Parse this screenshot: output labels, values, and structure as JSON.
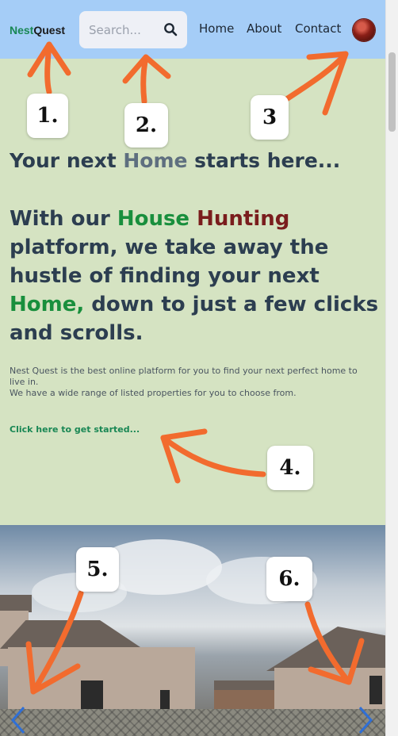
{
  "brand": {
    "part1": "Nest",
    "part2": "Quest"
  },
  "search": {
    "placeholder": "Search..."
  },
  "nav": {
    "links": [
      "Home",
      "About",
      "Contact"
    ]
  },
  "hero": {
    "title_pre": "Your next ",
    "title_hl": "Home",
    "title_post": " starts here...",
    "sub_1": "With our ",
    "sub_house": "House",
    "sub_space": " ",
    "sub_hunting": "Hunting",
    "sub_2": " platform, we take away the hustle of finding your next ",
    "sub_home": "Home,",
    "sub_3": " down to just a few clicks and scrolls.",
    "desc_1": "Nest Quest is the best online platform for you to find your next perfect home to live in.",
    "desc_2": "We have a wide range of listed properties for you to choose from.",
    "cta": "Click here to get started..."
  },
  "annotations": [
    "1.",
    "2.",
    "3",
    "4.",
    "5.",
    "6."
  ],
  "colors": {
    "navbar": "#a5cdf7",
    "page_bg": "#d5e3c2",
    "accent_green": "#198754",
    "heading": "#2c3e50",
    "annotation_arrow": "#f26b2e",
    "carousel_control": "#2f6fd6"
  },
  "icons": {
    "search": "magnifier",
    "carousel_prev": "chevron-left",
    "carousel_next": "chevron-right"
  }
}
